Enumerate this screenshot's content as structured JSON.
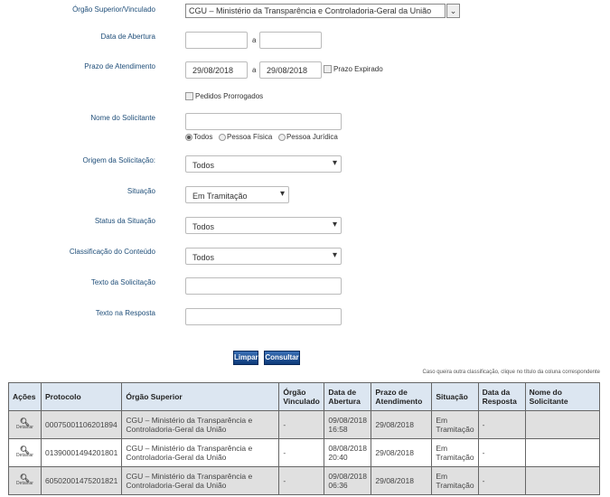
{
  "form": {
    "orgao": {
      "label": "Órgão Superior/Vinculado",
      "value": "CGU – Ministério da Transparência e Controladoria-Geral da União"
    },
    "data_abertura": {
      "label": "Data de Abertura",
      "from": "",
      "to": "",
      "sep": "a"
    },
    "prazo": {
      "label": "Prazo de Atendimento",
      "from": "29/08/2018",
      "to": "29/08/2018",
      "sep": "a",
      "expirado_label": "Prazo Expirado"
    },
    "prorrogados_label": "Pedidos Prorrogados",
    "nome": {
      "label": "Nome do Solicitante",
      "value": "",
      "radios": [
        "Todos",
        "Pessoa Física",
        "Pessoa Jurídica"
      ]
    },
    "origem": {
      "label": "Origem da Solicitação:",
      "value": "Todos"
    },
    "situacao": {
      "label": "Situação",
      "value": "Em Tramitação"
    },
    "status": {
      "label": "Status da Situação",
      "value": "Todos"
    },
    "classificacao": {
      "label": "Classificação do Conteúdo",
      "value": "Todos"
    },
    "texto_solicitacao": {
      "label": "Texto da Solicitação",
      "value": ""
    },
    "texto_resposta": {
      "label": "Texto na Resposta",
      "value": ""
    }
  },
  "buttons": {
    "limpar": "Limpar",
    "consultar": "Consultar"
  },
  "note": "Caso queira outra classificação, clique no título da coluna correspondente",
  "table": {
    "headers": [
      "Ações",
      "Protocolo",
      "Órgão Superior",
      "Órgão Vinculado",
      "Data de Abertura",
      "Prazo de Atendimento",
      "Situação",
      "Data da Resposta",
      "Nome do Solicitante"
    ],
    "detail_label": "Detalhar",
    "rows": [
      {
        "protocolo": "00075001106201894",
        "orgao": "CGU – Ministério da Transparência e Controladoria-Geral da União",
        "vinculado": "-",
        "abertura": "09/08/2018 16:58",
        "prazo": "29/08/2018",
        "situacao": "Em Tramitação",
        "resposta": "-",
        "nome": ""
      },
      {
        "protocolo": "01390001494201801",
        "orgao": "CGU – Ministério da Transparência e Controladoria-Geral da União",
        "vinculado": "-",
        "abertura": "08/08/2018 20:40",
        "prazo": "29/08/2018",
        "situacao": "Em Tramitação",
        "resposta": "-",
        "nome": ""
      },
      {
        "protocolo": "60502001475201821",
        "orgao": "CGU – Ministério da Transparência e Controladoria-Geral da União",
        "vinculado": "-",
        "abertura": "09/08/2018 06:36",
        "prazo": "29/08/2018",
        "situacao": "Em Tramitação",
        "resposta": "-",
        "nome": ""
      }
    ]
  }
}
